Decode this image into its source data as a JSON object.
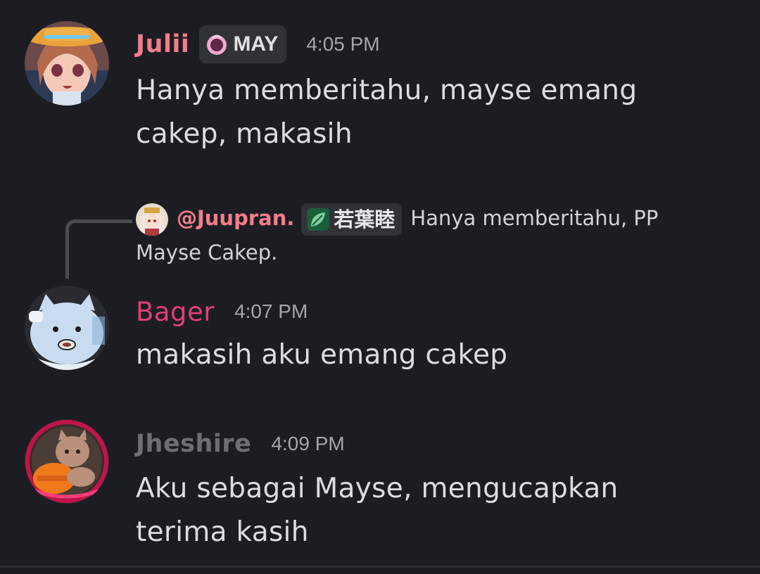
{
  "messages": [
    {
      "username": "Julii",
      "tag": "MAY",
      "timestamp": "4:05 PM",
      "content": "Hanya memberitahu, mayse emang cakep, makasih"
    },
    {
      "reply": {
        "mention": "@Juupran.",
        "tag": "若葉睦",
        "text": "Hanya memberitahu, PP Mayse Cakep."
      },
      "username": "Bager",
      "timestamp": "4:07 PM",
      "content": "makasih aku emang cakep"
    },
    {
      "username": "Jheshire",
      "timestamp": "4:09 PM",
      "content": "Aku sebagai Mayse, mengucapkan terima kasih"
    }
  ],
  "colors": {
    "background": "#1c1d22",
    "julii_name": "#f17d8c",
    "bager_name": "#e23e74",
    "jheshire_name": "#6f6f73",
    "mention": "#f17d8c"
  },
  "icons": {
    "tag_icon_1": "moon-ring-icon",
    "tag_icon_2": "leaf-icon"
  }
}
